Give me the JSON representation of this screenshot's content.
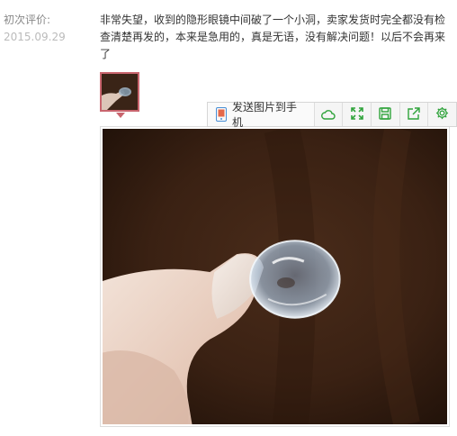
{
  "review": {
    "label": "初次评价:",
    "date": "2015.09.29",
    "text": "非常失望，收到的隐形眼镜中间破了一个小洞，卖家发货时完全都没有检查清楚再发的，本来是急用的，真是无语，没有解决问题！以后不会再来了"
  },
  "toolbar": {
    "send_label": "发送图片到手机",
    "buttons": [
      {
        "icon": "cloud-icon"
      },
      {
        "icon": "expand-icon"
      },
      {
        "icon": "save-icon"
      },
      {
        "icon": "share-icon"
      },
      {
        "icon": "gear-icon"
      }
    ]
  },
  "colors": {
    "toolbar_icon": "#2fa33b",
    "thumb_border": "#c9656e"
  }
}
